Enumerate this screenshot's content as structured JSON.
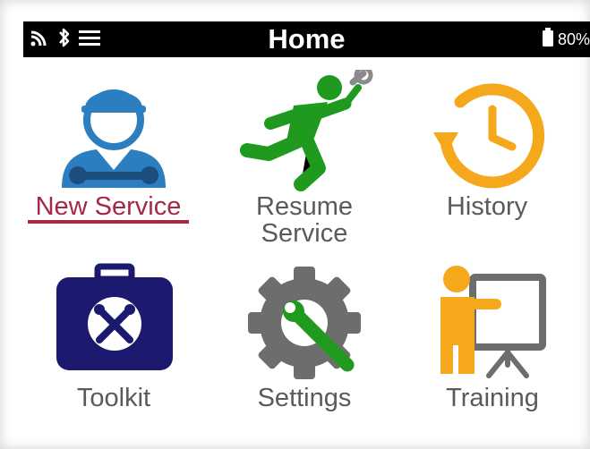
{
  "status_bar": {
    "title": "Home",
    "battery": "80%",
    "icons": [
      "wifi-icon",
      "bluetooth-icon",
      "menu-icon",
      "battery-icon"
    ]
  },
  "tiles": [
    {
      "label": "New Service",
      "icon": "mechanic-icon",
      "selected": true
    },
    {
      "label": "Resume\nService",
      "icon": "running-man-wrench-icon",
      "selected": false
    },
    {
      "label": "History",
      "icon": "clock-history-icon",
      "selected": false
    },
    {
      "label": "Toolkit",
      "icon": "toolbox-icon",
      "selected": false
    },
    {
      "label": "Settings",
      "icon": "gear-wrench-icon",
      "selected": false
    },
    {
      "label": "Training",
      "icon": "trainer-board-icon",
      "selected": false
    }
  ],
  "colors": {
    "status_bg": "#000000",
    "selected_text": "#a52848",
    "label_text": "#5a5a5a",
    "blue": "#2b7fc1",
    "green": "#1f9a1f",
    "orange": "#f5a81c",
    "navy": "#1b1a6e",
    "gray": "#6d6d6d"
  }
}
